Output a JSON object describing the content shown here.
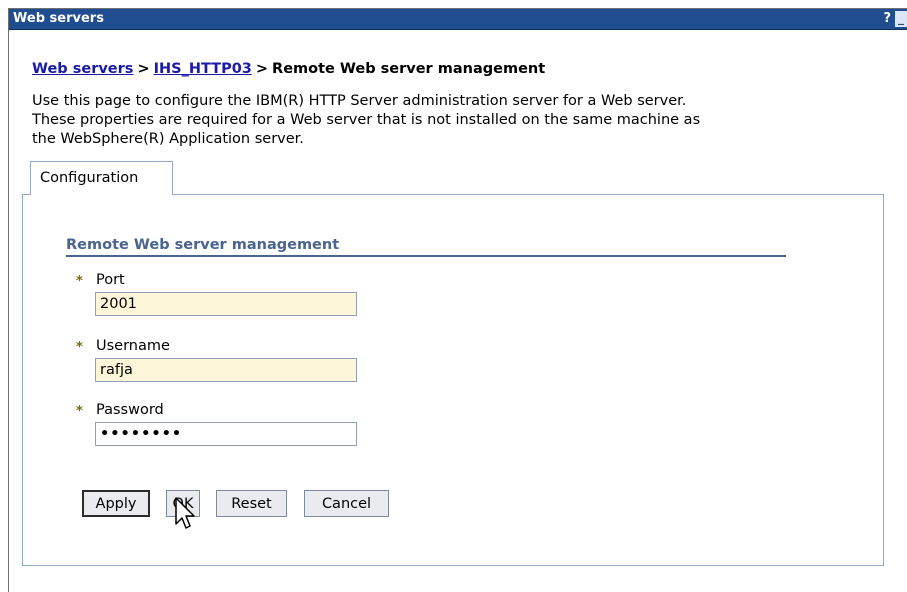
{
  "window": {
    "title": "Web servers",
    "help_label": "?",
    "minimize_label": "_"
  },
  "breadcrumb": {
    "link1": "Web servers",
    "sep1": ">",
    "link2": "IHS_HTTP03",
    "sep2": ">",
    "current": "Remote Web server management"
  },
  "description": {
    "line1": "Use this page to configure the IBM(R) HTTP Server administration server for a Web server.",
    "line2": "These properties are required for a Web server that is not installed on the same machine as",
    "line3": "the WebSphere(R) Application server."
  },
  "tabs": [
    {
      "label": "Configuration"
    }
  ],
  "section": {
    "title": "Remote Web server management"
  },
  "fields": {
    "required_marker": "*",
    "port": {
      "label": "Port",
      "value": "2001"
    },
    "username": {
      "label": "Username",
      "value": "rafja"
    },
    "password": {
      "label": "Password",
      "value": "••••••••"
    }
  },
  "buttons": {
    "apply": "Apply",
    "ok": "OK",
    "reset": "Reset",
    "cancel": "Cancel"
  },
  "icons": {
    "required": "asterisk-icon",
    "cursor": "mouse-pointer-icon"
  },
  "colors": {
    "titlebar": "#1f4d8f",
    "link": "#1a1aa6",
    "section_title": "#4a6490",
    "field_bg": "#fdf6d8"
  }
}
